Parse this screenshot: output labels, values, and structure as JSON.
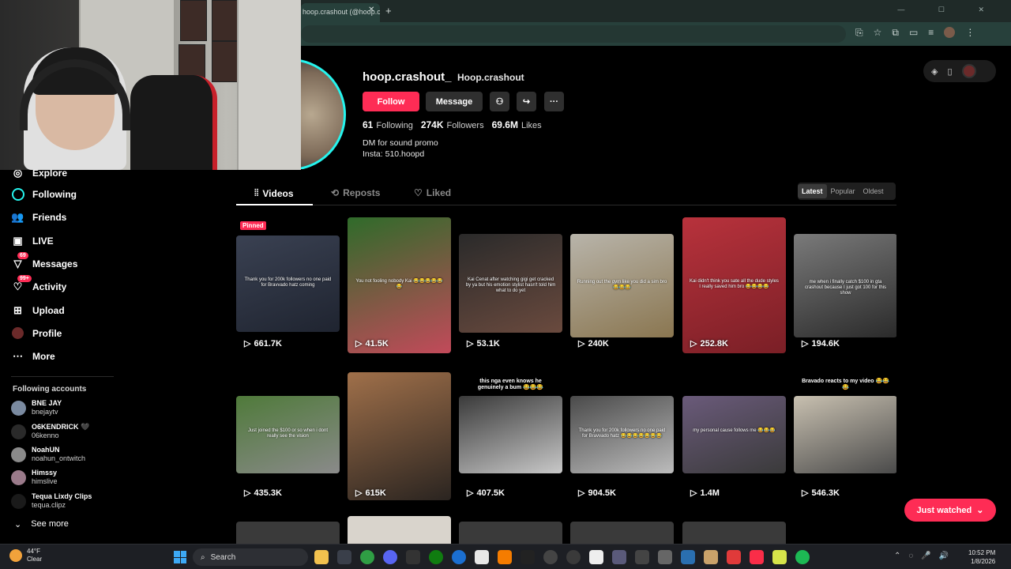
{
  "browser": {
    "tab_title": "hoop.crashout (@hoop.crashout",
    "tab_close": "✕",
    "new_tab": "+",
    "window_controls": "— ☐ ✕"
  },
  "sidebar": {
    "items": [
      {
        "label": "Explore",
        "icon": "compass-icon"
      },
      {
        "label": "Following",
        "icon": "following-ring-icon"
      },
      {
        "label": "Friends",
        "icon": "friends-icon"
      },
      {
        "label": "LIVE",
        "icon": "live-icon"
      },
      {
        "label": "Messages",
        "icon": "messages-icon",
        "badge": "69"
      },
      {
        "label": "Activity",
        "icon": "activity-icon",
        "badge": "99+"
      },
      {
        "label": "Upload",
        "icon": "upload-icon"
      },
      {
        "label": "Profile",
        "icon": "profile-avatar-icon"
      },
      {
        "label": "More",
        "icon": "more-icon"
      }
    ],
    "following_title": "Following accounts",
    "following": [
      {
        "name": "BNE JAY",
        "handle": "bnejaytv"
      },
      {
        "name": "O6KENDRICK 🖤",
        "handle": "06kenno"
      },
      {
        "name": "NoahUN",
        "handle": "noahun_ontwitch"
      },
      {
        "name": "Himssy",
        "handle": "himslive"
      },
      {
        "name": "Tequa Lixdy Clips",
        "handle": "tequa.clipz"
      }
    ],
    "see_more": "See more"
  },
  "profile": {
    "username": "hoop.crashout_",
    "nickname": "Hoop.crashout",
    "follow_label": "Follow",
    "message_label": "Message",
    "stats": {
      "following_count": "61",
      "following_label": "Following",
      "followers_count": "274K",
      "followers_label": "Followers",
      "likes_count": "69.6M",
      "likes_label": "Likes"
    },
    "bio_line1": "DM for sound promo",
    "bio_line2": "Insta: 510.hoopd"
  },
  "tabs": [
    {
      "label": "Videos"
    },
    {
      "label": "Reposts"
    },
    {
      "label": "Liked"
    }
  ],
  "sort": [
    "Latest",
    "Popular",
    "Oldest"
  ],
  "videos": [
    {
      "views": "661.7K",
      "pinned": "Pinned",
      "caption": "Thank you for 200k followers no one paid for Bravvado hatz coming",
      "colors": [
        "#3a4152",
        "#1f2430"
      ]
    },
    {
      "views": "41.5K",
      "caption": "You not fooling nobody Kai 😂😂😂😂😂😂",
      "colors": [
        "#2f6b2a",
        "#c24a5a"
      ]
    },
    {
      "views": "53.1K",
      "caption": "Kai Cenat after watching gigi get cracked by ya but his emotion stylist hasn't told him what to do yet",
      "colors": [
        "#2a2a2a",
        "#6a4a3e"
      ]
    },
    {
      "views": "240K",
      "caption": "Running out the gym like you did a sim bro 😂😂😂",
      "colors": [
        "#b8b4aa",
        "#8a7650"
      ]
    },
    {
      "views": "252.8K",
      "caption": "Kai didn't think you sate all the dude styles I really saved him bro 😂😂😂😂",
      "colors": [
        "#b8323c",
        "#7a1f26"
      ]
    },
    {
      "views": "194.6K",
      "caption": "me when i finally catch $100 in gta crashout because I just got 100 for this show",
      "colors": [
        "#7a7a7a",
        "#2a2a2a"
      ]
    },
    {
      "views": "435.3K",
      "caption": "Just joined the $100 or so when i dont really see the vision",
      "colors": [
        "#4f7a3a",
        "#8a8a8a"
      ]
    },
    {
      "views": "615K",
      "caption": "",
      "colors": [
        "#a0704a",
        "#2a2420"
      ]
    },
    {
      "views": "407.5K",
      "top_caption": "this nga even knows he genuinely a bum 😂😂😂",
      "caption": "",
      "colors": [
        "#3a3a3a",
        "#c8c8c8"
      ]
    },
    {
      "views": "904.5K",
      "caption": "Thank you for 200k followers no one paid for Bravvado hatz 😂😂😂😂😂😂😂",
      "colors": [
        "#4a4a4a",
        "#bcbcbc"
      ]
    },
    {
      "views": "1.4M",
      "caption": "my personal cause follows me 😂😂😂",
      "colors": [
        "#6a5a7a",
        "#3a3a3a"
      ]
    },
    {
      "views": "546.3K",
      "top_caption": "Bravado reacts to my video 😂😂😂",
      "caption": "",
      "colors": [
        "#c8c0b0",
        "#4a4a4a"
      ]
    }
  ],
  "just_watched": "Just watched",
  "taskbar": {
    "temp": "44°F",
    "condition": "Clear",
    "search_label": "Search",
    "time": "10:52 PM",
    "date": "1/8/2026"
  },
  "theme": {
    "accent": "#fe2c55",
    "cyan": "#25f4ee",
    "background": "#000000"
  }
}
